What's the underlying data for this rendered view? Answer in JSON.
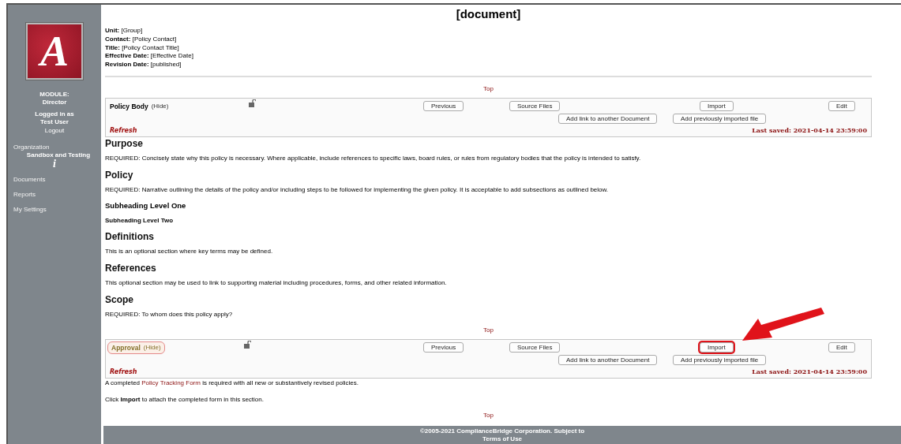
{
  "sidebar": {
    "logo_letter": "A",
    "module_label": "MODULE:",
    "module_value": "Director",
    "logged_in_label": "Logged in as",
    "user": "Test User",
    "logout": "Logout",
    "nav": [
      {
        "kind": "org",
        "label": "Organization",
        "sub": "Sandbox and Testing",
        "glyph": "i"
      },
      {
        "kind": "link",
        "label": "Documents"
      },
      {
        "kind": "link",
        "label": "Reports"
      },
      {
        "kind": "link",
        "label": "My Settings"
      }
    ]
  },
  "document": {
    "title": "[document]",
    "meta": [
      {
        "label": "Unit:",
        "value": "[Group]"
      },
      {
        "label": "Contact:",
        "value": "[Policy Contact]"
      },
      {
        "label": "Title:",
        "value": "[Policy Contact Title]"
      },
      {
        "label": "Effective Date:",
        "value": "[Effective Date]"
      },
      {
        "label": "Revision Date:",
        "value": "[published]"
      }
    ]
  },
  "content": [
    {
      "kind": "top",
      "text": "Top"
    },
    {
      "kind": "panel",
      "title": "Policy Body",
      "hide": "(Hide)",
      "highlighted": false,
      "buttons": [
        {
          "label": "Previous",
          "highlighted": false,
          "arrow": false
        },
        {
          "label": "Source Files",
          "highlighted": false,
          "arrow": false
        },
        {
          "label": "Import",
          "highlighted": false,
          "arrow": false
        },
        {
          "label": "Edit",
          "highlighted": false,
          "arrow": false
        }
      ],
      "extra_buttons": [
        "Add link to another Document",
        "Add previously imported file"
      ],
      "refresh": "Refresh",
      "last_saved": "Last saved: 2021-04-14 23:59:00"
    },
    {
      "kind": "h2",
      "text": "Purpose"
    },
    {
      "kind": "p",
      "text": "REQUIRED: Concisely state why this policy is necessary. Where applicable, include references to specific laws, board rules, or rules from regulatory bodies that the policy is intended to satisfy."
    },
    {
      "kind": "h2",
      "text": "Policy"
    },
    {
      "kind": "p",
      "text": "REQUIRED: Narrative outlining the details of the policy and/or including steps to be followed for implementing the given policy. It is acceptable to add subsections as outlined below."
    },
    {
      "kind": "h3",
      "text": "Subheading Level One"
    },
    {
      "kind": "h4",
      "text": "Subheading Level Two"
    },
    {
      "kind": "h2",
      "text": "Definitions"
    },
    {
      "kind": "p",
      "text": "This is an optional section where key terms may be defined."
    },
    {
      "kind": "h2",
      "text": "References"
    },
    {
      "kind": "p",
      "text": "This optional section may be used to link to supporting material including procedures, forms, and other related information."
    },
    {
      "kind": "h2",
      "text": "Scope"
    },
    {
      "kind": "p",
      "text": "REQUIRED: To whom does this policy apply?"
    },
    {
      "kind": "top",
      "text": "Top"
    },
    {
      "kind": "panel",
      "title": "Approval",
      "hide": "(Hide)",
      "highlighted": true,
      "buttons": [
        {
          "label": "Previous",
          "highlighted": false,
          "arrow": false
        },
        {
          "label": "Source Files",
          "highlighted": false,
          "arrow": false
        },
        {
          "label": "Import",
          "highlighted": true,
          "arrow": true
        },
        {
          "label": "Edit",
          "highlighted": false,
          "arrow": false
        }
      ],
      "extra_buttons": [
        "Add link to another Document",
        "Add previously imported file"
      ],
      "refresh": "Refresh",
      "last_saved": "Last saved: 2021-04-14 23:59:00"
    },
    {
      "kind": "plink",
      "before": "A completed ",
      "link": "Policy Tracking Form",
      "after": " is required with all new or substantively revised policies."
    },
    {
      "kind": "pgap",
      "text": "Click **Import** to attach the completed form in this section."
    },
    {
      "kind": "top",
      "text": "Top"
    }
  ],
  "footer": {
    "text": "©2005-2021 ComplianceBridge Corporation. Subject to",
    "link": "Terms of Use"
  }
}
